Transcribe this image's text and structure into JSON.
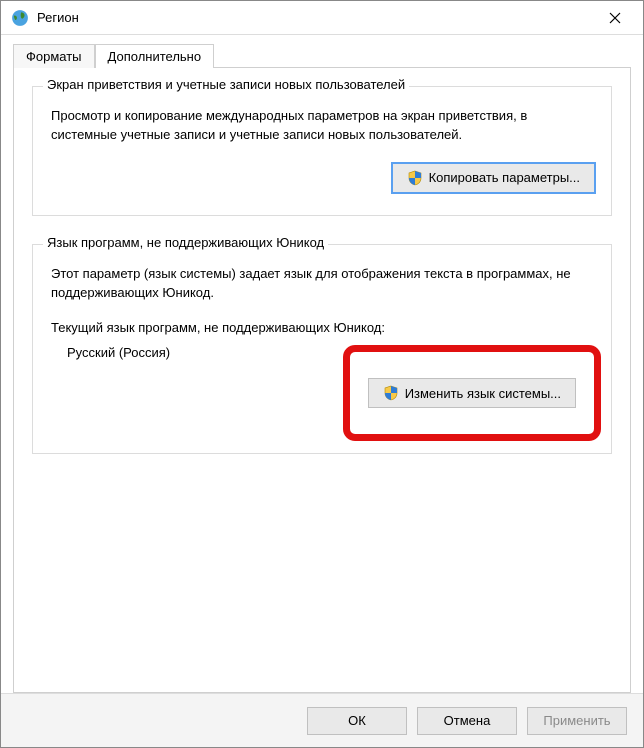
{
  "titlebar": {
    "title": "Регион"
  },
  "tabs": {
    "formats": "Форматы",
    "additional": "Дополнительно"
  },
  "group_welcome": {
    "title": "Экран приветствия и учетные записи новых пользователей",
    "desc": "Просмотр и копирование международных параметров на экран приветствия, в системные учетные записи и учетные записи новых пользователей.",
    "button": "Копировать параметры..."
  },
  "group_nonunicode": {
    "title": "Язык программ, не поддерживающих Юникод",
    "desc": "Этот параметр (язык системы) задает язык для отображения текста в программах, не поддерживающих Юникод.",
    "current_label": "Текущий язык программ, не поддерживающих Юникод:",
    "current_value": "Русский (Россия)",
    "button": "Изменить язык системы..."
  },
  "footer": {
    "ok": "ОК",
    "cancel": "Отмена",
    "apply": "Применить"
  }
}
